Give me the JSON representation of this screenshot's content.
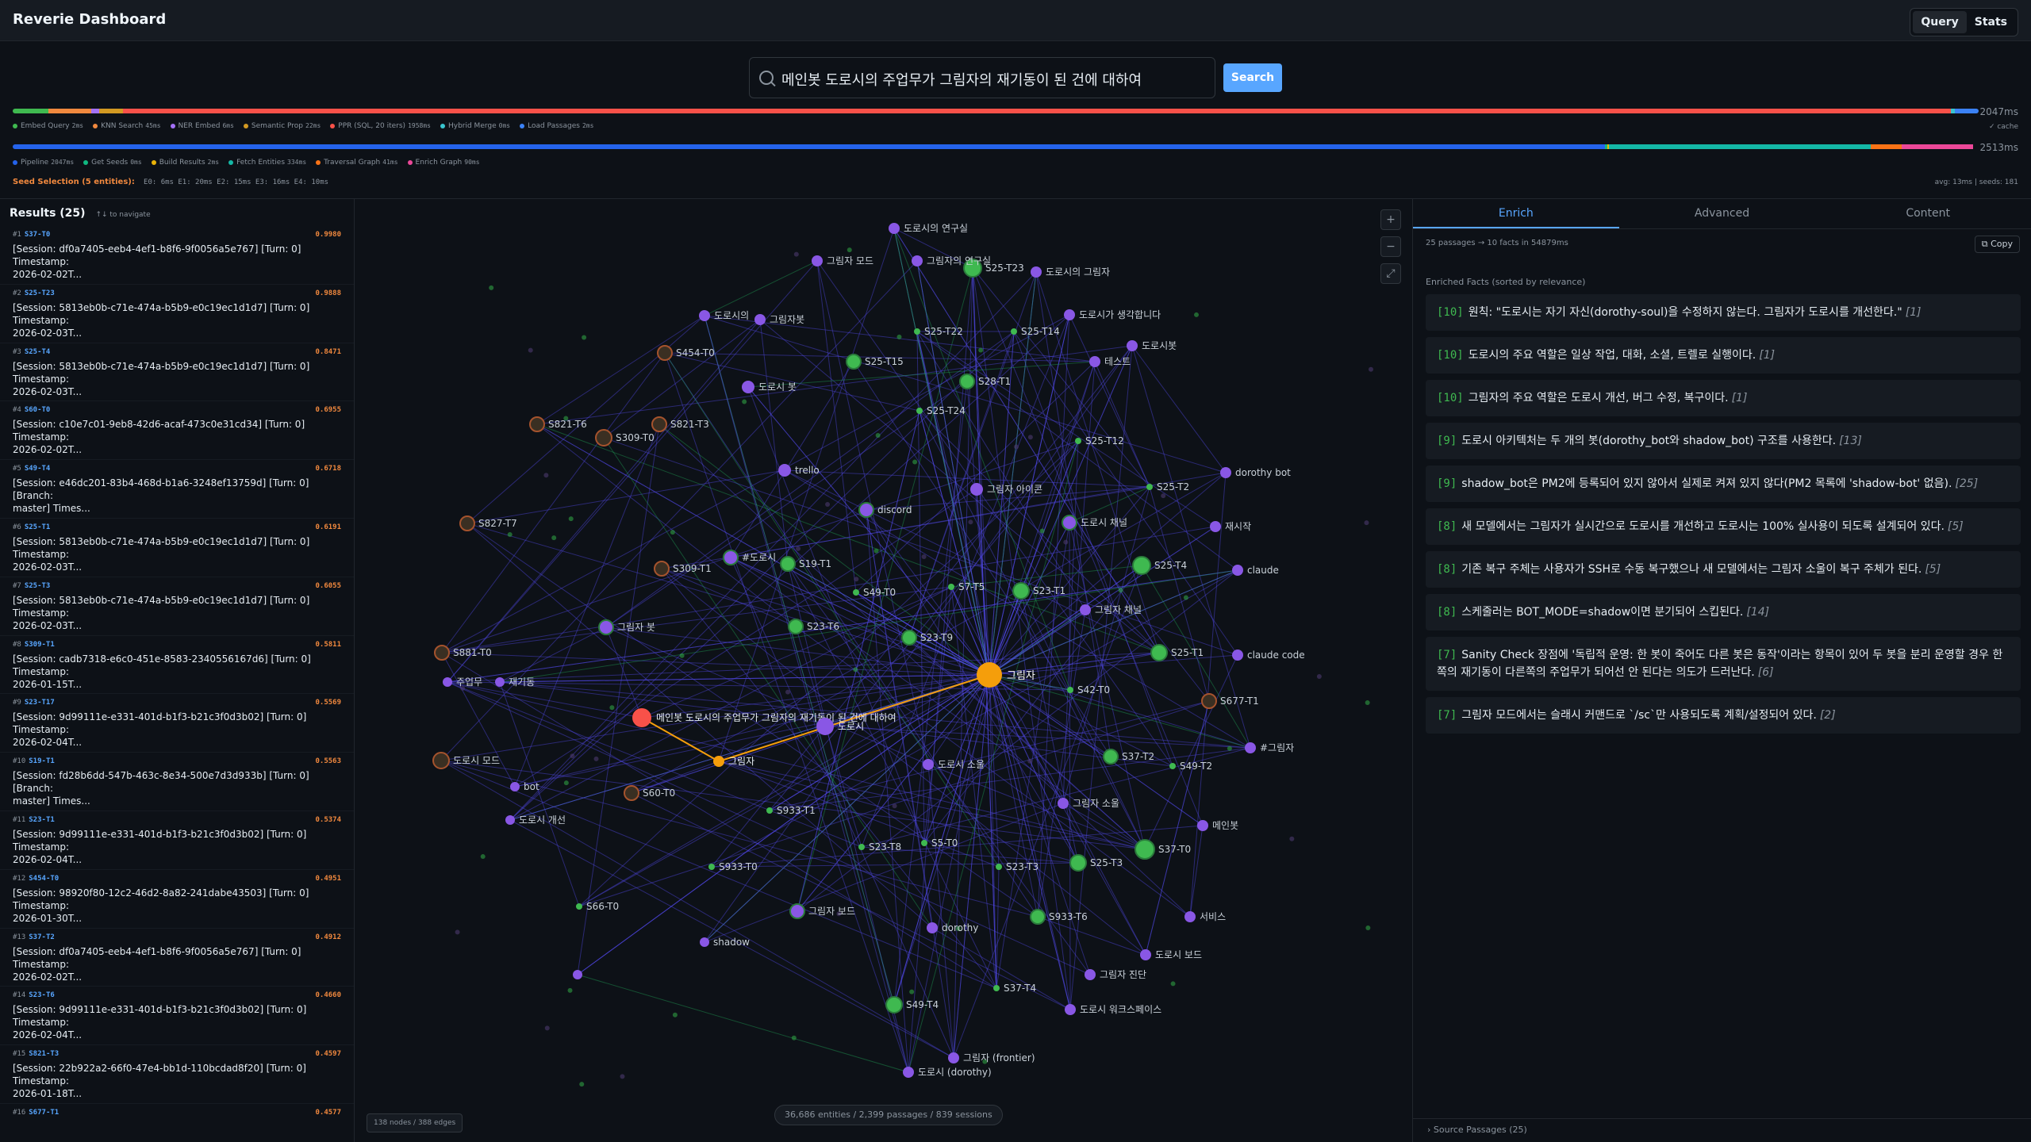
{
  "header": {
    "title": "Reverie Dashboard",
    "tabs": [
      "Query",
      "Stats"
    ],
    "active_tab": "Query"
  },
  "search": {
    "value": "메인봇 도로시의 주업무가 그림자의 재기동이 된 건에 대하여",
    "button_label": "Search"
  },
  "query_timing": {
    "total": "2047ms",
    "segments": [
      {
        "name": "Embed Query",
        "ms": "2ms",
        "color": "#3fb950",
        "share": 0.018
      },
      {
        "name": "KNN Search",
        "ms": "45ms",
        "color": "#f0883e",
        "share": 0.022
      },
      {
        "name": "NER Embed",
        "ms": "6ms",
        "color": "#a371f7",
        "share": 0.004
      },
      {
        "name": "Semantic Prop",
        "ms": "22ms",
        "color": "#d29922",
        "share": 0.012
      },
      {
        "name": "PPR (SQL, 20 iters)",
        "ms": "1958ms",
        "color": "#f85149",
        "share": 0.93
      },
      {
        "name": "Hybrid Merge",
        "ms": "0ms",
        "color": "#39c5cf",
        "share": 0.002
      },
      {
        "name": "Load Passages",
        "ms": "2ms",
        "color": "#3b82f6",
        "share": 0.012
      }
    ],
    "cache_label": "✓ cache"
  },
  "pipeline_timing": {
    "total": "2513ms",
    "segments": [
      {
        "name": "Pipeline",
        "ms": "2047ms",
        "color": "#2563eb",
        "share": 0.81
      },
      {
        "name": "Get Seeds",
        "ms": "0ms",
        "color": "#10b981",
        "share": 0.001
      },
      {
        "name": "Build Results",
        "ms": "2ms",
        "color": "#eab308",
        "share": 0.001
      },
      {
        "name": "Fetch Entities",
        "ms": "334ms",
        "color": "#14b8a6",
        "share": 0.133
      },
      {
        "name": "Traversal Graph",
        "ms": "41ms",
        "color": "#f97316",
        "share": 0.016
      },
      {
        "name": "Enrich Graph",
        "ms": "90ms",
        "color": "#ec4899",
        "share": 0.036
      }
    ]
  },
  "seed_selection": {
    "label": "Seed Selection (5 entities):",
    "values": "E0: 6ms   E1: 20ms   E2: 15ms   E3: 16ms   E4: 10ms",
    "stats": "avg: 13ms | seeds: 181"
  },
  "results": {
    "title": "Results (25)",
    "hint": "↑↓ to navigate",
    "items": [
      {
        "rank": "#1",
        "id": "S37-T0",
        "score": "0.9980",
        "line1": "[Session: df0a7405-eeb4-4ef1-b8f6-9f0056a5e767] [Turn: 0] Timestamp:",
        "line2": "2026-02-02T..."
      },
      {
        "rank": "#2",
        "id": "S25-T23",
        "score": "0.9888",
        "line1": "[Session: 5813eb0b-c71e-474a-b5b9-e0c19ec1d1d7] [Turn: 0] Timestamp:",
        "line2": "2026-02-03T..."
      },
      {
        "rank": "#3",
        "id": "S25-T4",
        "score": "0.8471",
        "line1": "[Session: 5813eb0b-c71e-474a-b5b9-e0c19ec1d1d7] [Turn: 0] Timestamp:",
        "line2": "2026-02-03T..."
      },
      {
        "rank": "#4",
        "id": "S60-T0",
        "score": "0.6955",
        "line1": "[Session: c10e7c01-9eb8-42d6-acaf-473c0e31cd34] [Turn: 0] Timestamp:",
        "line2": "2026-02-02T..."
      },
      {
        "rank": "#5",
        "id": "S49-T4",
        "score": "0.6718",
        "line1": "[Session: e46dc201-83b4-468d-b1a6-3248ef13759d] [Turn: 0] [Branch:",
        "line2": "master] Times..."
      },
      {
        "rank": "#6",
        "id": "S25-T1",
        "score": "0.6191",
        "line1": "[Session: 5813eb0b-c71e-474a-b5b9-e0c19ec1d1d7] [Turn: 0] Timestamp:",
        "line2": "2026-02-03T..."
      },
      {
        "rank": "#7",
        "id": "S25-T3",
        "score": "0.6055",
        "line1": "[Session: 5813eb0b-c71e-474a-b5b9-e0c19ec1d1d7] [Turn: 0] Timestamp:",
        "line2": "2026-02-03T..."
      },
      {
        "rank": "#8",
        "id": "S309-T1",
        "score": "0.5811",
        "line1": "[Session: cadb7318-e6c0-451e-8583-2340556167d6] [Turn: 0] Timestamp:",
        "line2": "2026-01-15T..."
      },
      {
        "rank": "#9",
        "id": "S23-T17",
        "score": "0.5569",
        "line1": "[Session: 9d99111e-e331-401d-b1f3-b21c3f0d3b02] [Turn: 0] Timestamp:",
        "line2": "2026-02-04T..."
      },
      {
        "rank": "#10",
        "id": "S19-T1",
        "score": "0.5563",
        "line1": "[Session: fd28b6dd-547b-463c-8e34-500e7d3d933b] [Turn: 0] [Branch:",
        "line2": "master] Times..."
      },
      {
        "rank": "#11",
        "id": "S23-T1",
        "score": "0.5374",
        "line1": "[Session: 9d99111e-e331-401d-b1f3-b21c3f0d3b02] [Turn: 0] Timestamp:",
        "line2": "2026-02-04T..."
      },
      {
        "rank": "#12",
        "id": "S454-T0",
        "score": "0.4951",
        "line1": "[Session: 98920f80-12c2-46d2-8a82-241dabe43503] [Turn: 0] Timestamp:",
        "line2": "2026-01-30T..."
      },
      {
        "rank": "#13",
        "id": "S37-T2",
        "score": "0.4912",
        "line1": "[Session: df0a7405-eeb4-4ef1-b8f6-9f0056a5e767] [Turn: 0] Timestamp:",
        "line2": "2026-02-02T..."
      },
      {
        "rank": "#14",
        "id": "S23-T6",
        "score": "0.4660",
        "line1": "[Session: 9d99111e-e331-401d-b1f3-b21c3f0d3b02] [Turn: 0] Timestamp:",
        "line2": "2026-02-04T..."
      },
      {
        "rank": "#15",
        "id": "S821-T3",
        "score": "0.4597",
        "line1": "[Session: 22b922a2-66f0-47e4-bb1d-110bcdad8f20] [Turn: 0] Timestamp:",
        "line2": "2026-01-18T..."
      },
      {
        "rank": "#16",
        "id": "S677-T1",
        "score": "0.4577",
        "line1": "",
        "line2": ""
      }
    ]
  },
  "graph": {
    "node_edge_count": "138 nodes / 388 edges",
    "footer": "36,686 entities / 2,399 passages / 839 sessions",
    "zoom_in": "+",
    "zoom_out": "−",
    "fit": "⤢",
    "colors": {
      "passage": "#3fb950",
      "entity": "#8957e5",
      "query": "#f85149",
      "seed": "#f59e0b",
      "edge": "#4f46e5"
    },
    "labels": {
      "query": "메인봇 도로시의 주업무가 그림자의 재기동이 된 건에 대하여",
      "center": "그림자",
      "seed_small": "그림자",
      "dorothy_main": "도로시",
      "nodes": [
        "S25-T23",
        "S25-T22",
        "S25-T14",
        "S25-T15",
        "S28-T1",
        "S25-T24",
        "S25-T12",
        "S25-T2",
        "S25-T4",
        "S25-T1",
        "S19-T1",
        "S49-T0",
        "S7-T5",
        "S23-T1",
        "S23-T6",
        "S23-T9",
        "S42-T0",
        "S37-T2",
        "S49-T2",
        "S37-T0",
        "S25-T3",
        "S933-T6",
        "S37-T4",
        "S49-T4",
        "S23-T8",
        "S5-T0",
        "S23-T3",
        "S933-T1",
        "S933-T0",
        "S66-T0",
        "S60-T0",
        "S309-T1",
        "S309-T0",
        "S821-T3",
        "S821-T6",
        "S827-T7",
        "S881-T0",
        "S454-T0",
        "S677-T1",
        "도로시 모드",
        "도로시의 연구실",
        "그림자 모드",
        "그림자의 연구실",
        "도로시의 그림자",
        "도로시가 생각합니다",
        "도로시의",
        "그림자봇",
        "도로시봇",
        "테스트",
        "도로시 봇",
        "trello",
        "그림자 아이콘",
        "dorothy bot",
        "discord",
        "도로시 채널",
        "재시작",
        "#도로시",
        "claude",
        "그림자 봇",
        "그림자 채널",
        "claude code",
        "재기동",
        "#그림자",
        "주업무",
        "bot",
        "도로시 소울",
        "그림자 소울",
        "메인봇",
        "도로시 개선",
        "서비스",
        "shadow",
        "dorothy",
        "그림자 보드",
        "도로시 보드",
        "그림자 진단",
        "도로시 워크스페이스",
        "그림자 (frontier)",
        "도로시 (dorothy)"
      ]
    }
  },
  "enrich": {
    "tabs": [
      "Enrich",
      "Advanced",
      "Content"
    ],
    "active_tab": "Enrich",
    "meta": "25 passages → 10 facts in 54879ms",
    "copy_label": "Copy",
    "facts_title": "Enriched Facts (sorted by relevance)",
    "facts": [
      {
        "score": "[10]",
        "text": "원칙: \"도로시는 자기 자신(dorothy-soul)을 수정하지 않는다. 그림자가 도로시를 개선한다.\"",
        "ref": "[1]"
      },
      {
        "score": "[10]",
        "text": "도로시의 주요 역할은 일상 작업, 대화, 소셜, 트렐로 실행이다.",
        "ref": "[1]"
      },
      {
        "score": "[10]",
        "text": "그림자의 주요 역할은 도로시 개선, 버그 수정, 복구이다.",
        "ref": "[1]"
      },
      {
        "score": "[9]",
        "text": "도로시 아키텍처는 두 개의 봇(dorothy_bot와 shadow_bot) 구조를 사용한다.",
        "ref": "[13]"
      },
      {
        "score": "[9]",
        "text": "shadow_bot은 PM2에 등록되어 있지 않아서 실제로 켜져 있지 않다(PM2 목록에 'shadow-bot' 없음).",
        "ref": "[25]"
      },
      {
        "score": "[8]",
        "text": "새 모델에서는 그림자가 실시간으로 도로시를 개선하고 도로시는 100% 실사용이 되도록 설계되어 있다.",
        "ref": "[5]"
      },
      {
        "score": "[8]",
        "text": "기존 복구 주체는 사용자가 SSH로 수동 복구했으나 새 모델에서는 그림자 소울이 복구 주체가 된다.",
        "ref": "[5]"
      },
      {
        "score": "[8]",
        "text": "스케줄러는 BOT_MODE=shadow이면 분기되어 스킵된다.",
        "ref": "[14]"
      },
      {
        "score": "[7]",
        "text": "Sanity Check 장점에 '독립적 운영: 한 봇이 죽어도 다른 봇은 동작'이라는 항목이 있어 두 봇을 분리 운영할 경우 한쪽의 재기동이 다른쪽의 주업무가 되어선 안 된다는 의도가 드러난다.",
        "ref": "[6]"
      },
      {
        "score": "[7]",
        "text": "그림자 모드에서는 슬래시 커맨드로 `/sc`만 사용되도록 계획/설정되어 있다.",
        "ref": "[2]"
      }
    ],
    "source_passages": "Source Passages (25)"
  }
}
